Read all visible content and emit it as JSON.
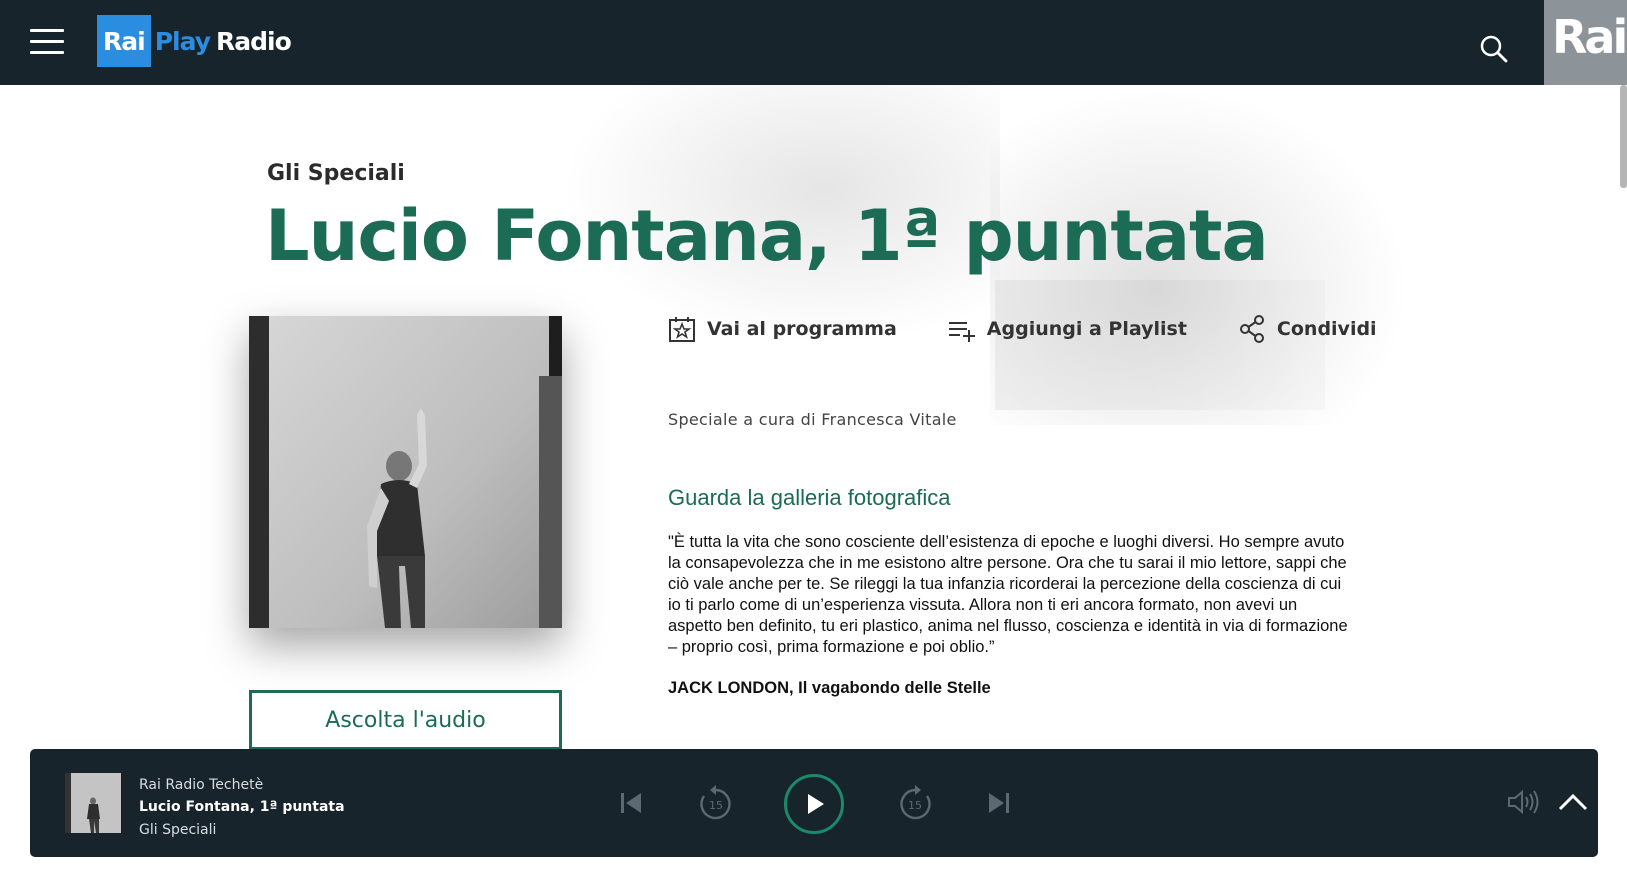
{
  "header": {
    "logo": {
      "rai": "Rai",
      "play": "Play",
      "radio": "Radio"
    },
    "corner_brand": "Rai",
    "menu_icon": "hamburger-menu-icon",
    "search_icon": "search-icon"
  },
  "episode": {
    "program": "Gli Speciali",
    "title": "Lucio Fontana, 1ª puntata",
    "listen_label": "Ascolta l'audio"
  },
  "actions": [
    {
      "label": "Vai al programma",
      "icon": "program-star-icon"
    },
    {
      "label": "Aggiungi a Playlist",
      "icon": "playlist-add-icon"
    },
    {
      "label": "Condividi",
      "icon": "share-icon"
    }
  ],
  "description": {
    "curator": "Speciale a cura di Francesca Vitale",
    "gallery_link": "Guarda la galleria fotografica",
    "quote": "\"È tutta la vita che sono cosciente dell’esistenza di epoche e luoghi diversi. Ho sempre avuto la consapevolezza che in me esistono altre persone. Ora che tu sarai il mio lettore, sappi che ciò vale anche per te. Se rileggi la tua infanzia ricorderai la percezione della coscienza di cui io ti parlo come di un’esperienza vissuta. Allora non ti eri ancora formato, non avevi un aspetto ben definito, tu eri plastico, anima nel flusso, coscienza e identità in via di formazione – proprio così, prima formazione e poi oblio.”",
    "quote_author": "JACK LONDON, Il vagabondo delle Stelle"
  },
  "player": {
    "channel": "Rai Radio Techetè",
    "title": "Lucio Fontana, 1ª puntata",
    "program": "Gli Speciali",
    "skip_back_seconds": "15",
    "skip_forward_seconds": "15",
    "controls": [
      "skip-previous-icon",
      "rewind-15-icon",
      "play-icon",
      "forward-15-icon",
      "skip-next-icon",
      "volume-icon",
      "expand-up-icon"
    ]
  },
  "colors": {
    "header_bg": "#17242b",
    "accent_green": "#1b6b55",
    "logo_blue": "#2b8ddf",
    "corner_grey": "#8d9499"
  }
}
